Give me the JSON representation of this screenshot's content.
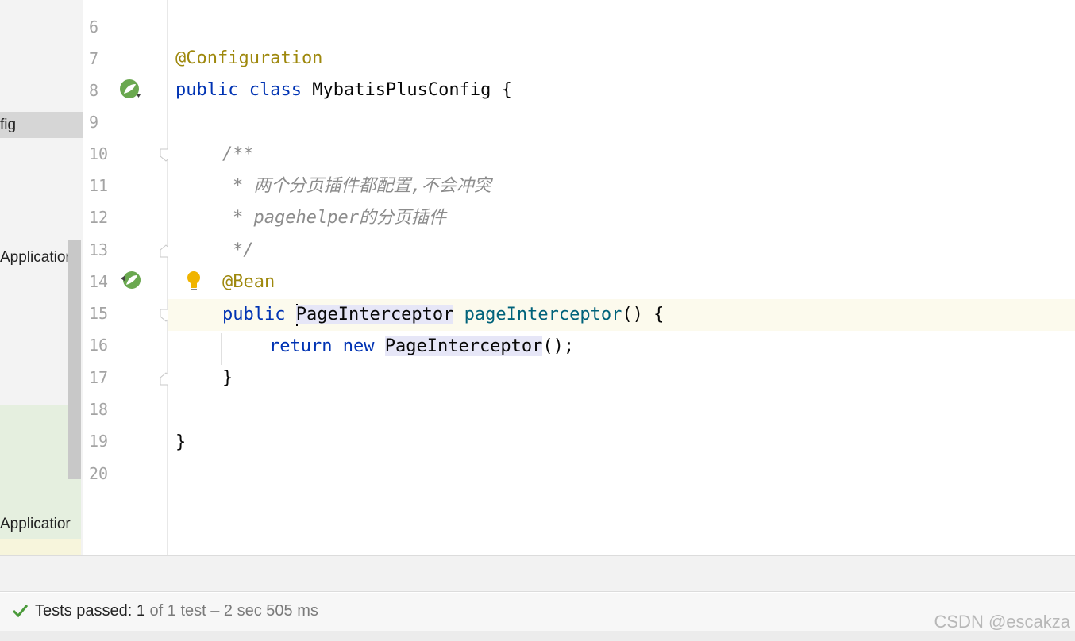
{
  "sidebar": {
    "selected_item": "fig",
    "item_application_1": "Applicatior",
    "item_application_2": "Applicatior"
  },
  "gutter": {
    "line_numbers": [
      "6",
      "7",
      "8",
      "9",
      "10",
      "11",
      "12",
      "13",
      "14",
      "15",
      "16",
      "17",
      "18",
      "19",
      "20"
    ]
  },
  "editor": {
    "line7_annotation": "@Configuration",
    "line8_kw1": "public",
    "line8_kw2": "class",
    "line8_name": "MybatisPlusConfig {",
    "line10_comment": "/**",
    "line11_comment": "* 两个分页插件都配置,不会冲突",
    "line12_comment": "* pagehelper的分页插件",
    "line13_comment": "*/",
    "line14_annotation": "@Bean",
    "line15_kw": "public",
    "line15_type": "PageInterceptor",
    "line15_method": "pageInterceptor",
    "line15_rest": "() {",
    "line16_kw1": "return",
    "line16_kw2": "new",
    "line16_type": "PageInterceptor",
    "line16_rest": "();",
    "line17_brace": "}",
    "line19_brace": "}"
  },
  "status": {
    "passed_label": "Tests passed: 1",
    "of_label": "of 1 test – 2 sec 505 ms"
  },
  "watermark": "CSDN @escakza",
  "colors": {
    "keyword": "#0033b3",
    "annotation": "#9e880d",
    "comment": "#8c8c8c",
    "method": "#00627a",
    "spring_icon": "#6aa84f",
    "bulb": "#f0b400"
  }
}
